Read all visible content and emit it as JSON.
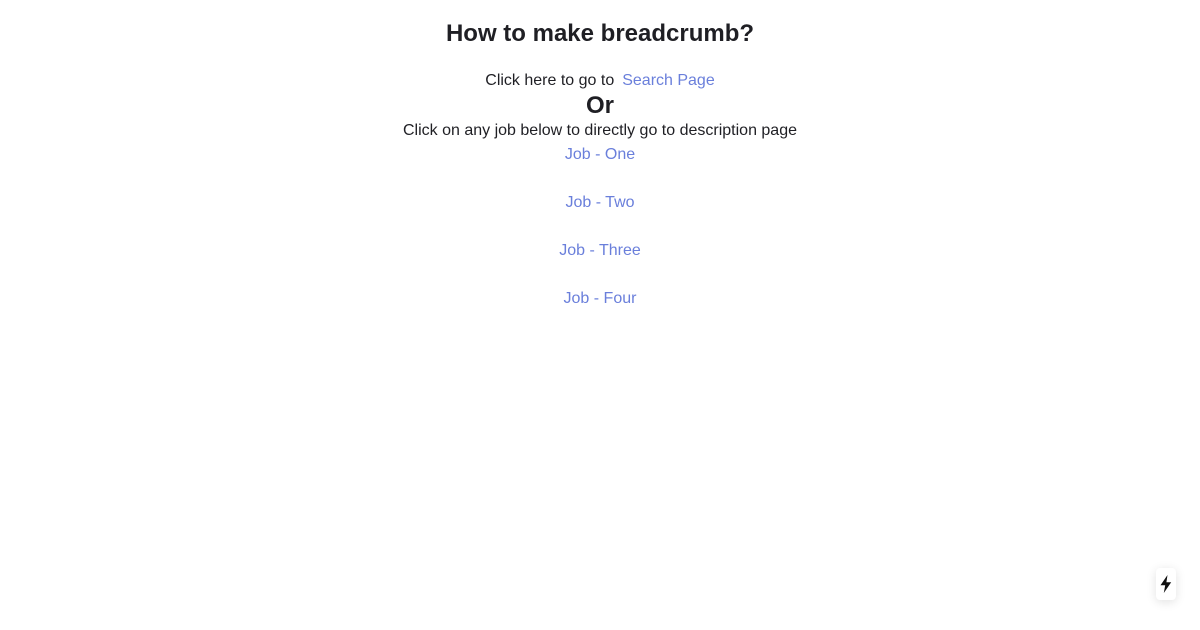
{
  "page": {
    "title": "How to make breadcrumb?",
    "search_prompt": "Click here to go to",
    "search_link": "Search Page",
    "or_text": "Or",
    "jobs_prompt": "Click on any job below to directly go to description page",
    "jobs": [
      {
        "label": "Job - One"
      },
      {
        "label": "Job - Two"
      },
      {
        "label": "Job - Three"
      },
      {
        "label": "Job - Four"
      }
    ]
  },
  "badge": {
    "icon": "lightning-bolt-icon"
  },
  "colors": {
    "text": "#1f1f24",
    "link": "#6a7fdb",
    "background": "#ffffff"
  }
}
